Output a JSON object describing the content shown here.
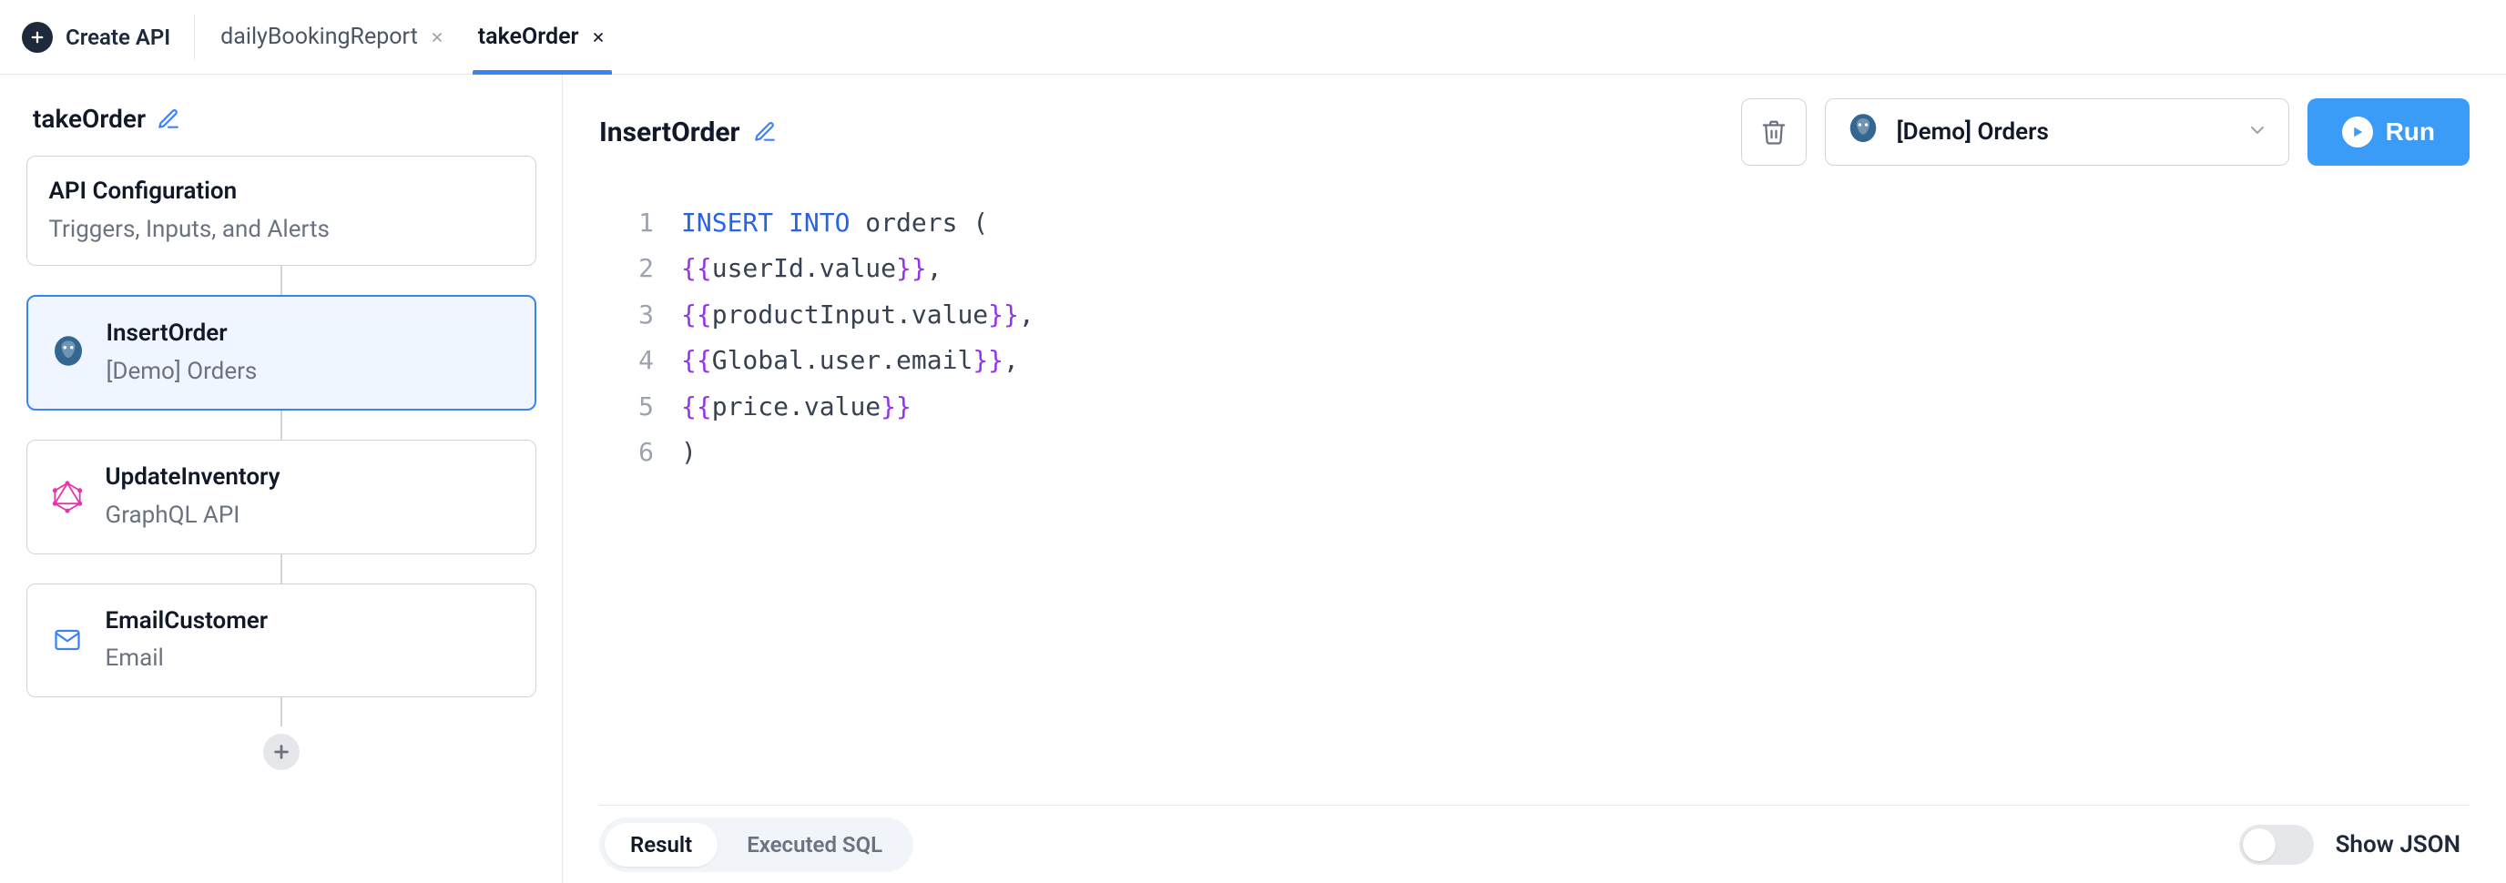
{
  "topbar": {
    "create_api_label": "Create API",
    "tabs": [
      {
        "label": "dailyBookingReport",
        "active": false
      },
      {
        "label": "takeOrder",
        "active": true
      }
    ]
  },
  "sidebar": {
    "title": "takeOrder",
    "config_node": {
      "title": "API Configuration",
      "sub": "Triggers, Inputs, and Alerts"
    },
    "steps": [
      {
        "name": "InsertOrder",
        "sub": "[Demo] Orders",
        "icon": "postgres",
        "active": true
      },
      {
        "name": "UpdateInventory",
        "sub": "GraphQL API",
        "icon": "graphql",
        "active": false
      },
      {
        "name": "EmailCustomer",
        "sub": "Email",
        "icon": "email",
        "active": false
      }
    ]
  },
  "main": {
    "step_title": "InsertOrder",
    "db_selector_label": "[Demo] Orders",
    "run_label": "Run",
    "code_lines": [
      {
        "n": "1",
        "tokens": [
          {
            "t": "INSERT",
            "cls": "kw"
          },
          {
            "t": " ",
            "cls": "plain"
          },
          {
            "t": "INTO",
            "cls": "kw"
          },
          {
            "t": " orders (",
            "cls": "plain"
          }
        ]
      },
      {
        "n": "2",
        "tokens": [
          {
            "t": "{{",
            "cls": "tmpl"
          },
          {
            "t": "userId",
            "cls": "tmpl-inner"
          },
          {
            "t": ".value",
            "cls": "plain"
          },
          {
            "t": "}}",
            "cls": "tmpl"
          },
          {
            "t": ",",
            "cls": "plain"
          }
        ]
      },
      {
        "n": "3",
        "tokens": [
          {
            "t": "{{",
            "cls": "tmpl"
          },
          {
            "t": "productInput",
            "cls": "tmpl-inner"
          },
          {
            "t": ".value",
            "cls": "plain"
          },
          {
            "t": "}}",
            "cls": "tmpl"
          },
          {
            "t": ",",
            "cls": "plain"
          }
        ]
      },
      {
        "n": "4",
        "tokens": [
          {
            "t": "{{",
            "cls": "tmpl"
          },
          {
            "t": "Global",
            "cls": "tmpl-inner"
          },
          {
            "t": ".user.email",
            "cls": "plain"
          },
          {
            "t": "}}",
            "cls": "tmpl"
          },
          {
            "t": ",",
            "cls": "plain"
          }
        ]
      },
      {
        "n": "5",
        "tokens": [
          {
            "t": "{{",
            "cls": "tmpl"
          },
          {
            "t": "price",
            "cls": "tmpl-inner"
          },
          {
            "t": ".value",
            "cls": "plain"
          },
          {
            "t": "}}",
            "cls": "tmpl"
          }
        ]
      },
      {
        "n": "6",
        "tokens": [
          {
            "t": ")",
            "cls": "plain"
          }
        ]
      }
    ]
  },
  "footer": {
    "pills": [
      {
        "label": "Result",
        "active": true
      },
      {
        "label": "Executed SQL",
        "active": false
      }
    ],
    "toggle_label": "Show JSON",
    "toggle_on": false
  },
  "colors": {
    "accent": "#3b82f6",
    "run": "#3b9cf7",
    "keyword": "#2563eb",
    "template": "#9333ea",
    "graphql": "#e535ab",
    "email": "#3b82f6",
    "postgres": "#336791"
  }
}
